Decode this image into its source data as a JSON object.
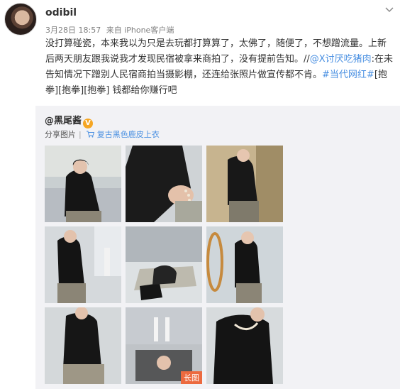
{
  "post": {
    "username": "odibil",
    "date": "3月28日 18:57",
    "source": "来自 iPhone客户端",
    "text_line1": "没打算碰瓷，本来我以为只是去玩都打算算了，太佛了，随便了，不想蹭流量。",
    "text_line2": "上新后两天朋友跟我说我才发现民宿被拿来商拍了，没有提前告知。//",
    "mention": "@X讨厌吃猪肉",
    "text_line3": ":在未告知情况下蹭别人民宿商拍当摄影棚，还连给张照片做宣传都不肯。",
    "hashtag": "#当代网红#",
    "tail": "[抱拳][抱拳][抱拳] 钱都给你赚行吧"
  },
  "repost": {
    "author": "@黑尾酱",
    "badge": "V",
    "share_label": "分享图片",
    "product_label": "复古黑色鹿皮上衣",
    "long_image_badge": "长图"
  },
  "colors": {
    "link": "#eb7350",
    "accent_blue": "#4a90e2",
    "repost_bg": "#f2f2f5"
  }
}
